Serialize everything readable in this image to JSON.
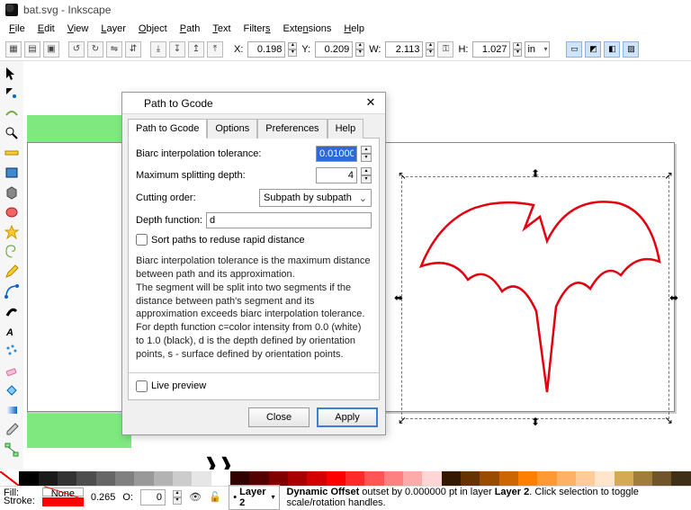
{
  "window": {
    "title": "bat.svg - Inkscape"
  },
  "menu": {
    "file": "File",
    "edit": "Edit",
    "view": "View",
    "layer": "Layer",
    "object": "Object",
    "path": "Path",
    "text": "Text",
    "filters": "Filters",
    "extensions": "Extensions",
    "help": "Help"
  },
  "toolbar": {
    "x_label": "X:",
    "x": "0.198",
    "y_label": "Y:",
    "y": "0.209",
    "w_label": "W:",
    "w": "2.113",
    "h_label": "H:",
    "h": "1.027",
    "unit": "in"
  },
  "dialog": {
    "title": "Path to Gcode",
    "tabs": {
      "main": "Path to Gcode",
      "options": "Options",
      "prefs": "Preferences",
      "help": "Help"
    },
    "biarc_label": "Biarc interpolation tolerance:",
    "biarc_value": "0.01000",
    "depth_label": "Maximum splitting depth:",
    "depth_value": "4",
    "cutting_label": "Cutting order:",
    "cutting_value": "Subpath by subpath",
    "depthfn_label": "Depth function:",
    "depthfn_value": "d",
    "sort_label": "Sort paths to reduse rapid distance",
    "helptext": "Biarc interpolation tolerance is the maximum distance between path and its approximation.\nThe segment will be split into two segments if the distance between path's segment and its approximation exceeds biarc interpolation tolerance.\nFor depth function c=color intensity from 0.0 (white) to 1.0 (black), d is the depth defined by orientation points, s - surface defined by orientation points.",
    "live_preview": "Live preview",
    "close": "Close",
    "apply": "Apply"
  },
  "status": {
    "fill_label": "Fill:",
    "stroke_label": "Stroke:",
    "fill_value": "None",
    "stroke_num": "0.265",
    "opacity_label": "O:",
    "opacity": "0",
    "layer": "Layer 2",
    "message": "Dynamic Offset outset by 0.000000 pt in layer Layer 2. Click selection to toggle scale/rotation handles."
  },
  "palette": [
    "#000000",
    "#1a1a1a",
    "#333333",
    "#4d4d4d",
    "#666666",
    "#808080",
    "#999999",
    "#b3b3b3",
    "#cccccc",
    "#e6e6e6",
    "#ffffff",
    "#330000",
    "#550000",
    "#800000",
    "#aa0000",
    "#d40000",
    "#ff0000",
    "#ff2a2a",
    "#ff5555",
    "#ff8080",
    "#ffaaaa",
    "#ffd5d5",
    "#331900",
    "#663300",
    "#994c00",
    "#cc6600",
    "#ff7f00",
    "#ff9933",
    "#ffb266",
    "#ffcc99",
    "#ffe5cc",
    "#d4aa55",
    "#a17d3b",
    "#70552a",
    "#3f2f16"
  ]
}
